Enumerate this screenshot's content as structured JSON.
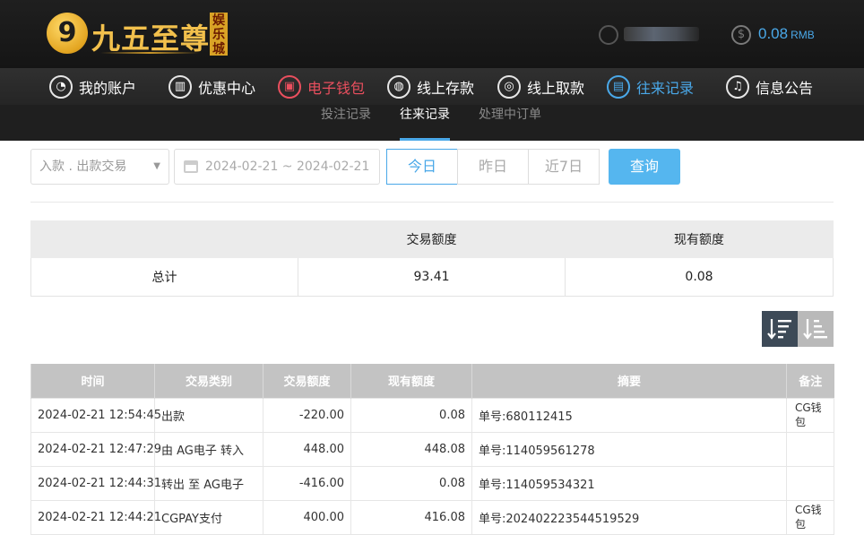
{
  "header": {
    "logo_badge": "9",
    "logo_text": "九五至尊",
    "logo_tag": "娱乐城",
    "balance_value": "0.08",
    "balance_unit": "RMB",
    "coin_symbol": "$"
  },
  "nav": {
    "items": [
      {
        "label": "我的账户",
        "icon": "user-icon",
        "glyph": "◔"
      },
      {
        "label": "优惠中心",
        "icon": "gift-icon",
        "glyph": "▥"
      },
      {
        "label": "电子钱包",
        "icon": "wallet-icon",
        "glyph": "▣"
      },
      {
        "label": "线上存款",
        "icon": "deposit-icon",
        "glyph": "◍"
      },
      {
        "label": "线上取款",
        "icon": "withdraw-icon",
        "glyph": "◎"
      },
      {
        "label": "往来记录",
        "icon": "record-icon",
        "glyph": "▤"
      },
      {
        "label": "信息公告",
        "icon": "bell-icon",
        "glyph": "♫"
      }
    ],
    "colors": {
      "default": "#ffffff",
      "wallet": "#ea4f5e",
      "active": "#4aa8e8"
    }
  },
  "subnav": {
    "tabs": [
      {
        "label": "投注记录"
      },
      {
        "label": "往来记录"
      },
      {
        "label": "处理中订单"
      }
    ]
  },
  "filter": {
    "type_select": "入款 . 出款交易",
    "date_range": "2024-02-21 ~ 2024-02-21",
    "quick_today": "今日",
    "quick_yesterday": "昨日",
    "quick_7days": "近7日",
    "query_label": "查询"
  },
  "summary": {
    "headers": [
      "",
      "交易额度",
      "现有额度"
    ],
    "row": {
      "label": "总计",
      "amount": "93.41",
      "balance": "0.08"
    }
  },
  "records": {
    "headers": [
      "时间",
      "交易类别",
      "交易额度",
      "现有额度",
      "摘要",
      "备注"
    ],
    "rows": [
      {
        "time": "2024-02-21 12:54:45",
        "type": "出款",
        "amount": "-220.00",
        "balance": "0.08",
        "summary": "单号:680112415",
        "note": "CG钱包"
      },
      {
        "time": "2024-02-21 12:47:29",
        "type": "由 AG电子 转入",
        "amount": "448.00",
        "balance": "448.08",
        "summary": "单号:114059561278",
        "note": ""
      },
      {
        "time": "2024-02-21 12:44:31",
        "type": "转出 至 AG电子",
        "amount": "-416.00",
        "balance": "0.08",
        "summary": "单号:114059534321",
        "note": ""
      },
      {
        "time": "2024-02-21 12:44:21",
        "type": "CGPAY支付",
        "amount": "400.00",
        "balance": "416.08",
        "summary": "单号:202402223544519529",
        "note": "CG钱包"
      }
    ]
  }
}
